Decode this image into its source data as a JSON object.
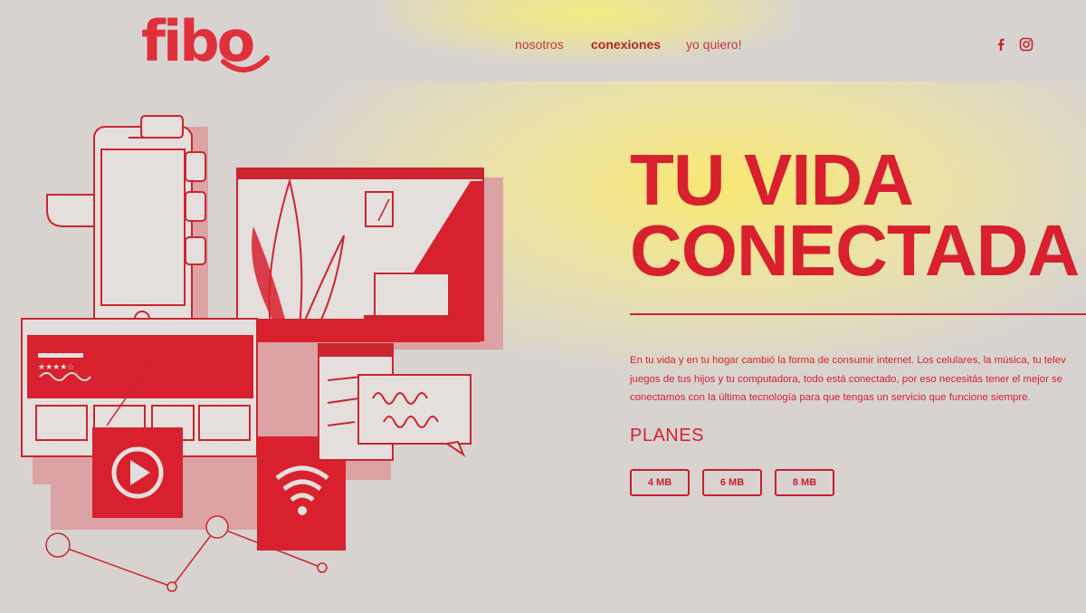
{
  "header": {
    "logo": "fibo",
    "nav": [
      "nosotros",
      "conexiones",
      "yo quiero!"
    ],
    "social_icons": [
      "facebook-icon",
      "instagram-icon"
    ]
  },
  "hero": {
    "title_line1": "TU VIDA",
    "title_line2": "CONECTADA",
    "description": [
      "En tu vida y en tu hogar cambió la forma de consumir internet. Los celulares, la música, tu telev",
      "juegos de tus hijos y tu computadora, todo está conectado, por eso necesitás tener el mejor se",
      "conectamos con la última tecnología para que tengas un servicio que funcione siempre."
    ],
    "plans_label": "PLANES",
    "plans": [
      "4 MB",
      "6 MB",
      "8 MB"
    ]
  },
  "illustration": {
    "rating_stars": "★★★★☆"
  },
  "colors": {
    "accent": "#d8202e",
    "background": "#d8d3d0",
    "highlight": "#f7ec78",
    "illustration_shadow": "#dca2a4"
  }
}
